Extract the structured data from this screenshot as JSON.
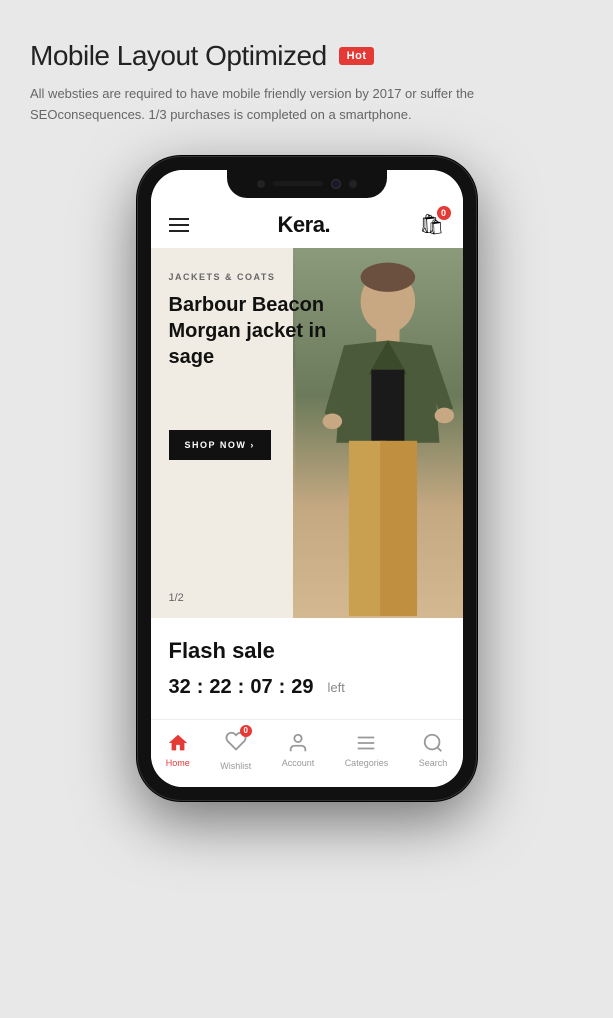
{
  "header": {
    "title": "Mobile Layout Optimized",
    "badge": "Hot",
    "subtitle": "All websties are required to have mobile friendly version by 2017 or suffer the SEOconsequences. 1/3 purchases is completed on a smartphone."
  },
  "phone": {
    "navbar": {
      "logo": "Kera.",
      "cart_count": "0"
    },
    "hero": {
      "category": "JACKETS & COATS",
      "title": "Barbour Beacon Morgan jacket in sage",
      "cta": "SHOP NOW ›",
      "pagination": "1/2"
    },
    "flash_sale": {
      "title": "Flash sale",
      "countdown": {
        "hours": "32",
        "minutes": "22",
        "seconds": "07",
        "milliseconds": "29",
        "label": "left"
      }
    },
    "bottom_nav": {
      "items": [
        {
          "id": "home",
          "label": "Home",
          "active": true
        },
        {
          "id": "wishlist",
          "label": "Wishlist",
          "active": false,
          "badge": "0"
        },
        {
          "id": "account",
          "label": "Account",
          "active": false
        },
        {
          "id": "categories",
          "label": "Categories",
          "active": false
        },
        {
          "id": "search",
          "label": "Search",
          "active": false
        }
      ]
    }
  },
  "colors": {
    "accent": "#e53935",
    "primary": "#111111",
    "background": "#e8e8e8",
    "hero_bg": "#f0ebe3"
  }
}
